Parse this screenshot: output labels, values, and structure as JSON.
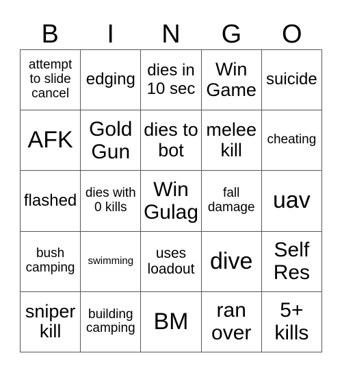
{
  "header": [
    "B",
    "I",
    "N",
    "G",
    "O"
  ],
  "cells": [
    "attempt to slide cancel",
    "edging",
    "dies in 10 sec",
    "Win Game",
    "suicide",
    "AFK",
    "Gold Gun",
    "dies to bot",
    "melee kill",
    "cheating",
    "flashed",
    "dies with 0 kills",
    "Win Gulag",
    "fall damage",
    "uav",
    "bush camping",
    "swimming",
    "uses loadout",
    "dive",
    "Self Res",
    "sniper kill",
    "building camping",
    "BM",
    "ran over",
    "5+ kills"
  ]
}
